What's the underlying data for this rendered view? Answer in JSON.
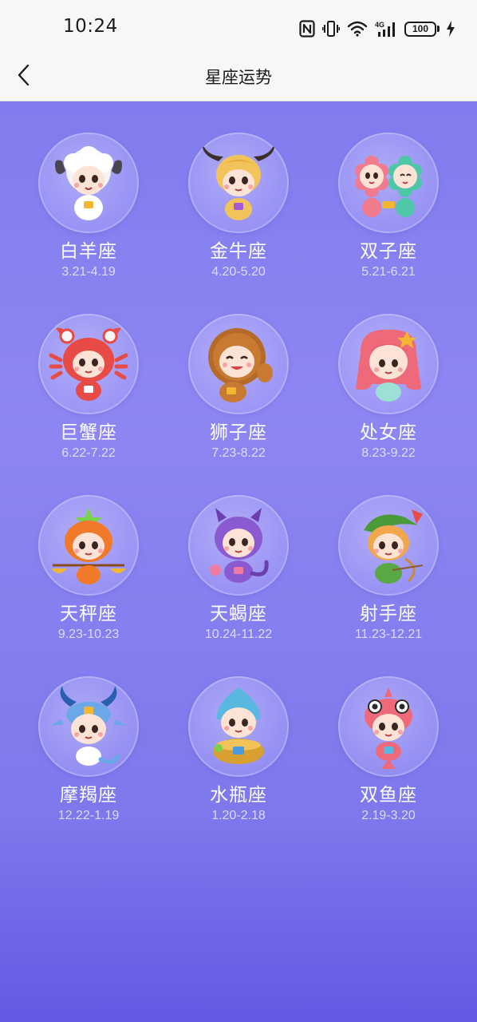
{
  "status_bar": {
    "time": "10:24",
    "icons": [
      "nfc-icon",
      "vibrate-icon",
      "wifi-icon",
      "4g-signal-icon",
      "battery-icon",
      "charging-icon"
    ],
    "network": "4G",
    "battery": "100"
  },
  "nav": {
    "title": "星座运势",
    "back_icon": "chevron-left-icon"
  },
  "zodiacs": [
    {
      "name": "白羊座",
      "dates": "3.21-4.19",
      "icon": "aries-mascot-icon"
    },
    {
      "name": "金牛座",
      "dates": "4.20-5.20",
      "icon": "taurus-mascot-icon"
    },
    {
      "name": "双子座",
      "dates": "5.21-6.21",
      "icon": "gemini-mascot-icon"
    },
    {
      "name": "巨蟹座",
      "dates": "6.22-7.22",
      "icon": "cancer-mascot-icon"
    },
    {
      "name": "狮子座",
      "dates": "7.23-8.22",
      "icon": "leo-mascot-icon"
    },
    {
      "name": "处女座",
      "dates": "8.23-9.22",
      "icon": "virgo-mascot-icon"
    },
    {
      "name": "天秤座",
      "dates": "9.23-10.23",
      "icon": "libra-mascot-icon"
    },
    {
      "name": "天蝎座",
      "dates": "10.24-11.22",
      "icon": "scorpio-mascot-icon"
    },
    {
      "name": "射手座",
      "dates": "11.23-12.21",
      "icon": "sagittarius-mascot-icon"
    },
    {
      "name": "摩羯座",
      "dates": "12.22-1.19",
      "icon": "capricorn-mascot-icon"
    },
    {
      "name": "水瓶座",
      "dates": "1.20-2.18",
      "icon": "aquarius-mascot-icon"
    },
    {
      "name": "双鱼座",
      "dates": "2.19-3.20",
      "icon": "pisces-mascot-icon"
    }
  ],
  "colors": {
    "background_top": "#7c79ee",
    "background_bottom": "#6359e4",
    "bar_background": "#f7f7f7",
    "name_text": "#ffffff"
  }
}
